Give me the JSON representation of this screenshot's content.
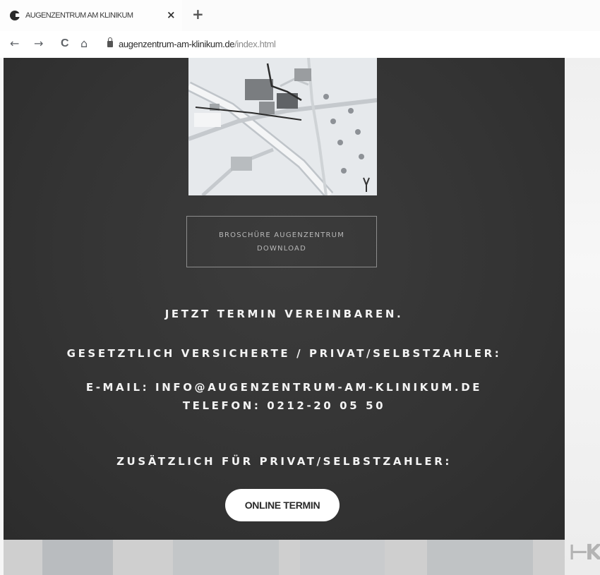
{
  "browser": {
    "tab_title": "AUGENZENTRUM AM KLINIKUM",
    "tab_close": "×",
    "new_tab": "+",
    "back": "←",
    "forward": "→",
    "reload": "C",
    "home": "⌂",
    "url_host": "augenzentrum-am-klinikum.de",
    "url_path": "/index.html"
  },
  "main": {
    "brochure_line1": "BROSCHÜRE AUGENZENTRUM",
    "brochure_line2": "DOWNLOAD",
    "appointment_heading": "JETZT TERMIN VEREINBAREN.",
    "insured_heading": "GESETZTLICH VERSICHERTE / PRIVAT/SELBSTZAHLER:",
    "email_line": "E-MAIL: INFO@AUGENZENTRUM-AM-KLINIKUM.DE",
    "phone_line": "TELEFON: 0212-20 05 50",
    "private_heading": "ZUSÄTZLICH FÜR PRIVAT/SELBSTZAHLER:",
    "online_button": "ONLINE TERMIN"
  },
  "icons": {
    "favicon": "site-favicon",
    "map": "location-map-image",
    "lock": "lock-icon"
  },
  "colors": {
    "content_bg": "#363636",
    "button_bg": "#ffffff",
    "text_light": "#f3f3f3",
    "brochure_border": "#8d8d8d"
  }
}
